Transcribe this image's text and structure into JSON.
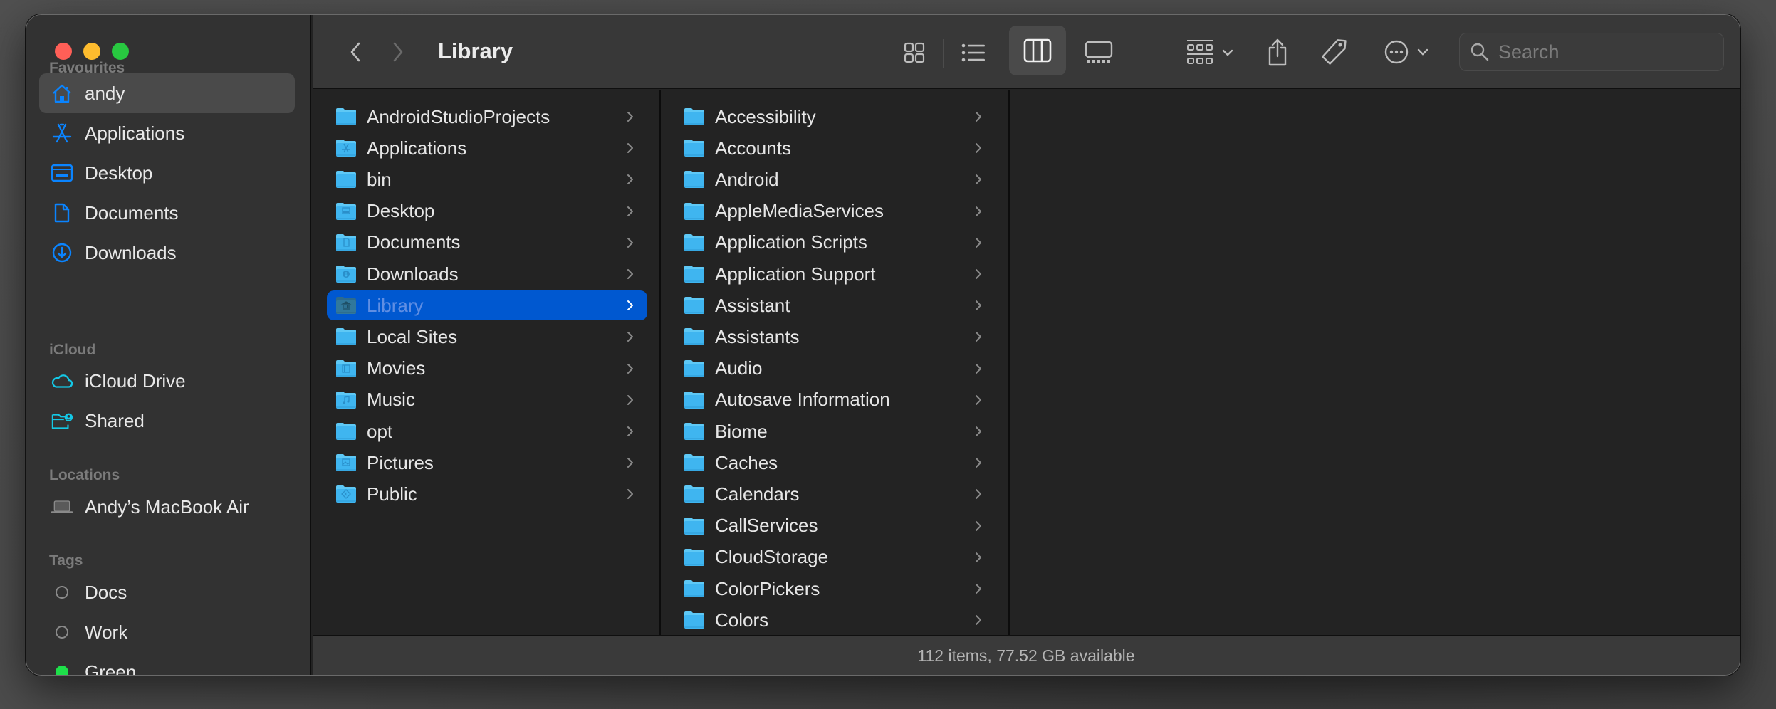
{
  "window": {
    "title": "Library",
    "traffic_lights": {
      "close_color": "#ff5f57",
      "minimize_color": "#febc2e",
      "zoom_color": "#28c840"
    }
  },
  "sidebar": {
    "sections": [
      {
        "label": "Favourites",
        "items": [
          {
            "label": "andy",
            "icon": "home-icon",
            "selected": true
          },
          {
            "label": "Applications",
            "icon": "app-store-icon"
          },
          {
            "label": "Desktop",
            "icon": "desktop-icon"
          },
          {
            "label": "Documents",
            "icon": "document-icon"
          },
          {
            "label": "Downloads",
            "icon": "download-icon"
          }
        ]
      },
      {
        "label": "iCloud",
        "items": [
          {
            "label": "iCloud Drive",
            "icon": "cloud-icon"
          },
          {
            "label": "Shared",
            "icon": "shared-folder-icon"
          }
        ]
      },
      {
        "label": "Locations",
        "items": [
          {
            "label": "Andy’s MacBook Air",
            "icon": "laptop-icon"
          }
        ]
      },
      {
        "label": "Tags",
        "items": [
          {
            "label": "Docs",
            "color": "none"
          },
          {
            "label": "Work",
            "color": "none"
          },
          {
            "label": "Green",
            "color": "#1ee04a"
          }
        ]
      }
    ]
  },
  "toolbar": {
    "back": "back-icon",
    "forward": "forward-icon",
    "views": [
      "icon-view",
      "list-view",
      "column-view",
      "gallery-view"
    ],
    "selected_view": "column-view",
    "group_label": "group-by",
    "share": "share-icon",
    "tags": "tag-icon",
    "more": "more-icon",
    "search": {
      "placeholder": "Search",
      "value": ""
    }
  },
  "columns": [
    {
      "items": [
        {
          "name": "AndroidStudioProjects",
          "glyph": ""
        },
        {
          "name": "Applications",
          "glyph": "A"
        },
        {
          "name": "bin",
          "glyph": ""
        },
        {
          "name": "Desktop",
          "glyph": "desk"
        },
        {
          "name": "Documents",
          "glyph": "doc"
        },
        {
          "name": "Downloads",
          "glyph": "dl"
        },
        {
          "name": "Library",
          "glyph": "lib",
          "selected": true
        },
        {
          "name": "Local Sites",
          "glyph": ""
        },
        {
          "name": "Movies",
          "glyph": "film"
        },
        {
          "name": "Music",
          "glyph": "note"
        },
        {
          "name": "opt",
          "glyph": ""
        },
        {
          "name": "Pictures",
          "glyph": "pic"
        },
        {
          "name": "Public",
          "glyph": "pub"
        }
      ]
    },
    {
      "items": [
        {
          "name": "Accessibility"
        },
        {
          "name": "Accounts"
        },
        {
          "name": "Android"
        },
        {
          "name": "AppleMediaServices"
        },
        {
          "name": "Application Scripts"
        },
        {
          "name": "Application Support"
        },
        {
          "name": "Assistant"
        },
        {
          "name": "Assistants"
        },
        {
          "name": "Audio"
        },
        {
          "name": "Autosave Information"
        },
        {
          "name": "Biome"
        },
        {
          "name": "Caches"
        },
        {
          "name": "Calendars"
        },
        {
          "name": "CallServices"
        },
        {
          "name": "CloudStorage"
        },
        {
          "name": "ColorPickers"
        },
        {
          "name": "Colors"
        }
      ]
    }
  ],
  "status": {
    "text": "112 items, 77.52 GB available"
  },
  "colors": {
    "accent": "#0a84ff",
    "selection": "#0058d0",
    "folder": "#3fb5f0"
  }
}
